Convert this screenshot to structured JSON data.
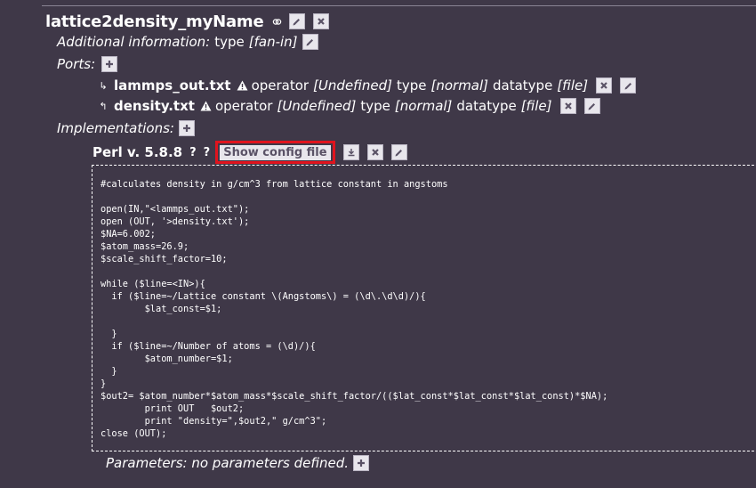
{
  "node": {
    "title": "lattice2density_myName",
    "icons": {
      "link": "link-icon",
      "edit": "pencil-icon",
      "delete": "close-icon",
      "add": "plus-icon",
      "download": "download-icon",
      "warning": "warning-icon"
    }
  },
  "additional_info": {
    "label": "Additional information:",
    "key": "type",
    "value": "[fan-in]"
  },
  "ports": {
    "label": "Ports:",
    "items": [
      {
        "name": "lammps_out.txt",
        "direction": "input",
        "operator_label": "operator",
        "operator_value": "[Undefined]",
        "type_label": "type",
        "type_value": "[normal]",
        "datatype_label": "datatype",
        "datatype_value": "[file]"
      },
      {
        "name": "density.txt",
        "direction": "output",
        "operator_label": "operator",
        "operator_value": "[Undefined]",
        "type_label": "type",
        "type_value": "[normal]",
        "datatype_label": "datatype",
        "datatype_value": "[file]"
      }
    ]
  },
  "implementations": {
    "label": "Implementations:",
    "items": [
      {
        "name": "Perl v. 5.8.8",
        "help1": "?",
        "help2": "?",
        "config_button": "Show config file",
        "code": "#calculates density in g/cm^3 from lattice constant in angstoms\n\nopen(IN,\"<lammps_out.txt\");\nopen (OUT, '>density.txt');\n$NA=6.002;\n$atom_mass=26.9;\n$scale_shift_factor=10;\n\nwhile ($line=<IN>){\n  if ($line=~/Lattice constant \\(Angstoms\\) = (\\d\\.\\d\\d)/){\n        $lat_const=$1;\n\n  }\n  if ($line=~/Number of atoms = (\\d)/){\n        $atom_number=$1;\n  }\n}\n$out2= $atom_number*$atom_mass*$scale_shift_factor/(($lat_const*$lat_const*$lat_const)*$NA);\n        print OUT   $out2;\n        print \"density=\",$out2,\" g/cm^3\";\nclose (OUT);"
      }
    ]
  },
  "parameters": {
    "text": "Parameters: no parameters defined."
  },
  "colors": {
    "background": "#3f3848",
    "button_bg": "#e8e6ec",
    "button_fg": "#5a5266",
    "highlight": "#e0141e"
  }
}
